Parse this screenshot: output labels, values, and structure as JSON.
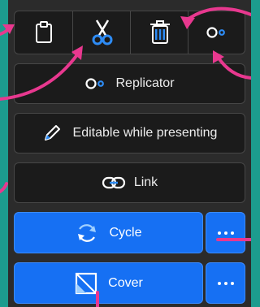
{
  "toolbar": {
    "icons": [
      "clipboard-icon",
      "scissors-icon",
      "trash-icon",
      "replicator-icon"
    ]
  },
  "menu": {
    "replicator_label": "Replicator",
    "editable_label": "Editable while presenting",
    "link_label": "Link",
    "cycle_label": "Cycle",
    "cover_label": "Cover"
  },
  "colors": {
    "background": "#1c9c8e",
    "panel": "#2b2b2b",
    "button": "#1b1b1b",
    "accent_blue": "#1670f3",
    "annotation_pink": "#e8388f"
  }
}
